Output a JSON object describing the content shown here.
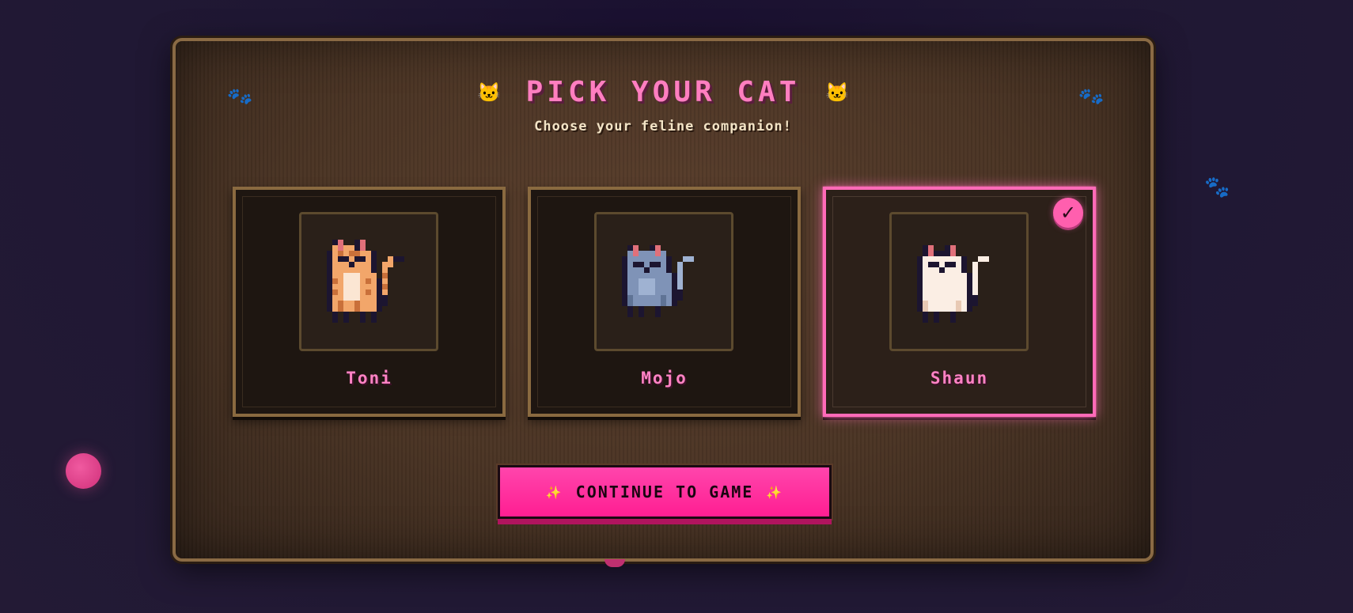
{
  "header": {
    "title": "PICK YOUR CAT",
    "subtitle": "Choose your feline companion!",
    "title_icon_left": "🐱",
    "title_icon_right": "🐱",
    "paw_glyph": "🐾"
  },
  "cats": [
    {
      "name": "Toni",
      "coat": "orange-tabby",
      "selected": false
    },
    {
      "name": "Mojo",
      "coat": "blue-gray",
      "selected": false
    },
    {
      "name": "Shaun",
      "coat": "white",
      "selected": true
    }
  ],
  "selected_check": "✓",
  "cta": {
    "label": "CONTINUE TO GAME",
    "sparkle_left": "✨",
    "sparkle_right": "✨"
  },
  "colors": {
    "accent_pink": "#ff6ab8",
    "button_pink": "#ff2e9a",
    "panel_brown": "#4a3424",
    "frame_gold": "#8a6a44"
  }
}
